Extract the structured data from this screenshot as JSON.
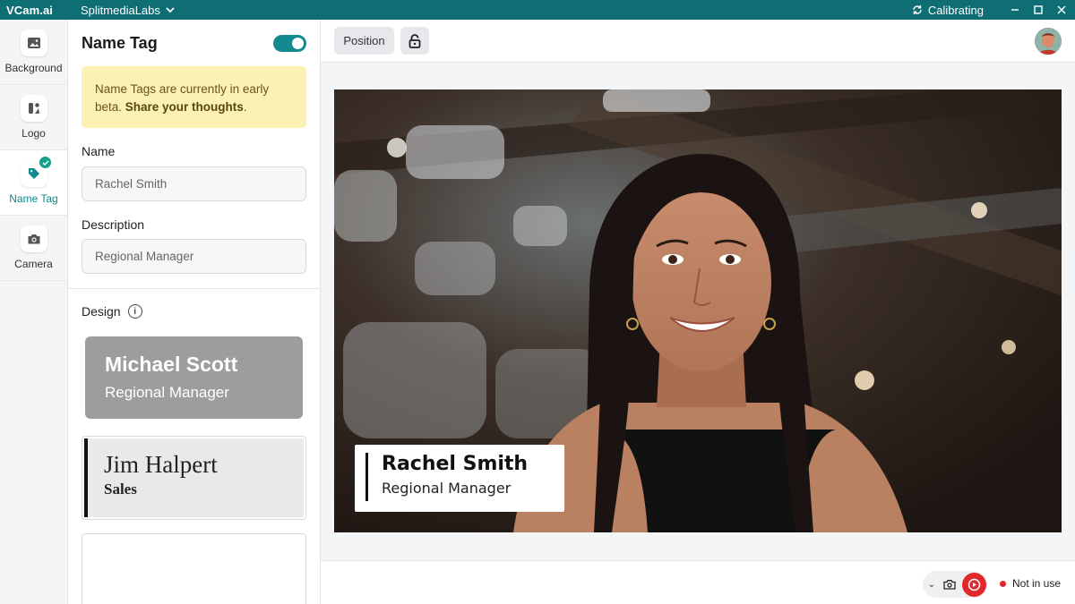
{
  "titlebar": {
    "app_name": "VCam.ai",
    "org_name": "SplitmediaLabs",
    "status": "Calibrating",
    "bg_color": "#0e6e74"
  },
  "leftnav": {
    "items": [
      {
        "label": "Background",
        "icon": "image-icon",
        "active": false
      },
      {
        "label": "Logo",
        "icon": "logo-icon",
        "active": false
      },
      {
        "label": "Name Tag",
        "icon": "tag-icon",
        "active": true
      },
      {
        "label": "Camera",
        "icon": "camera-icon",
        "active": false
      }
    ],
    "accent": "#0f8a8f"
  },
  "panel": {
    "title": "Name Tag",
    "toggle_on": true,
    "beta_text": "Name Tags are currently in early beta. ",
    "beta_link": "Share your thoughts",
    "beta_end": ".",
    "name_label": "Name",
    "name_value": "Rachel Smith",
    "description_label": "Description",
    "description_value": "Regional Manager",
    "design_label": "Design",
    "designs": [
      {
        "name": "Michael Scott",
        "description": "Regional Manager"
      },
      {
        "name": "Jim Halpert",
        "description": "Sales"
      }
    ]
  },
  "main": {
    "position_button": "Position",
    "preview_tag": {
      "name": "Rachel Smith",
      "description": "Regional Manager"
    },
    "status_text": "Not in use",
    "record_color": "#e0282d"
  }
}
